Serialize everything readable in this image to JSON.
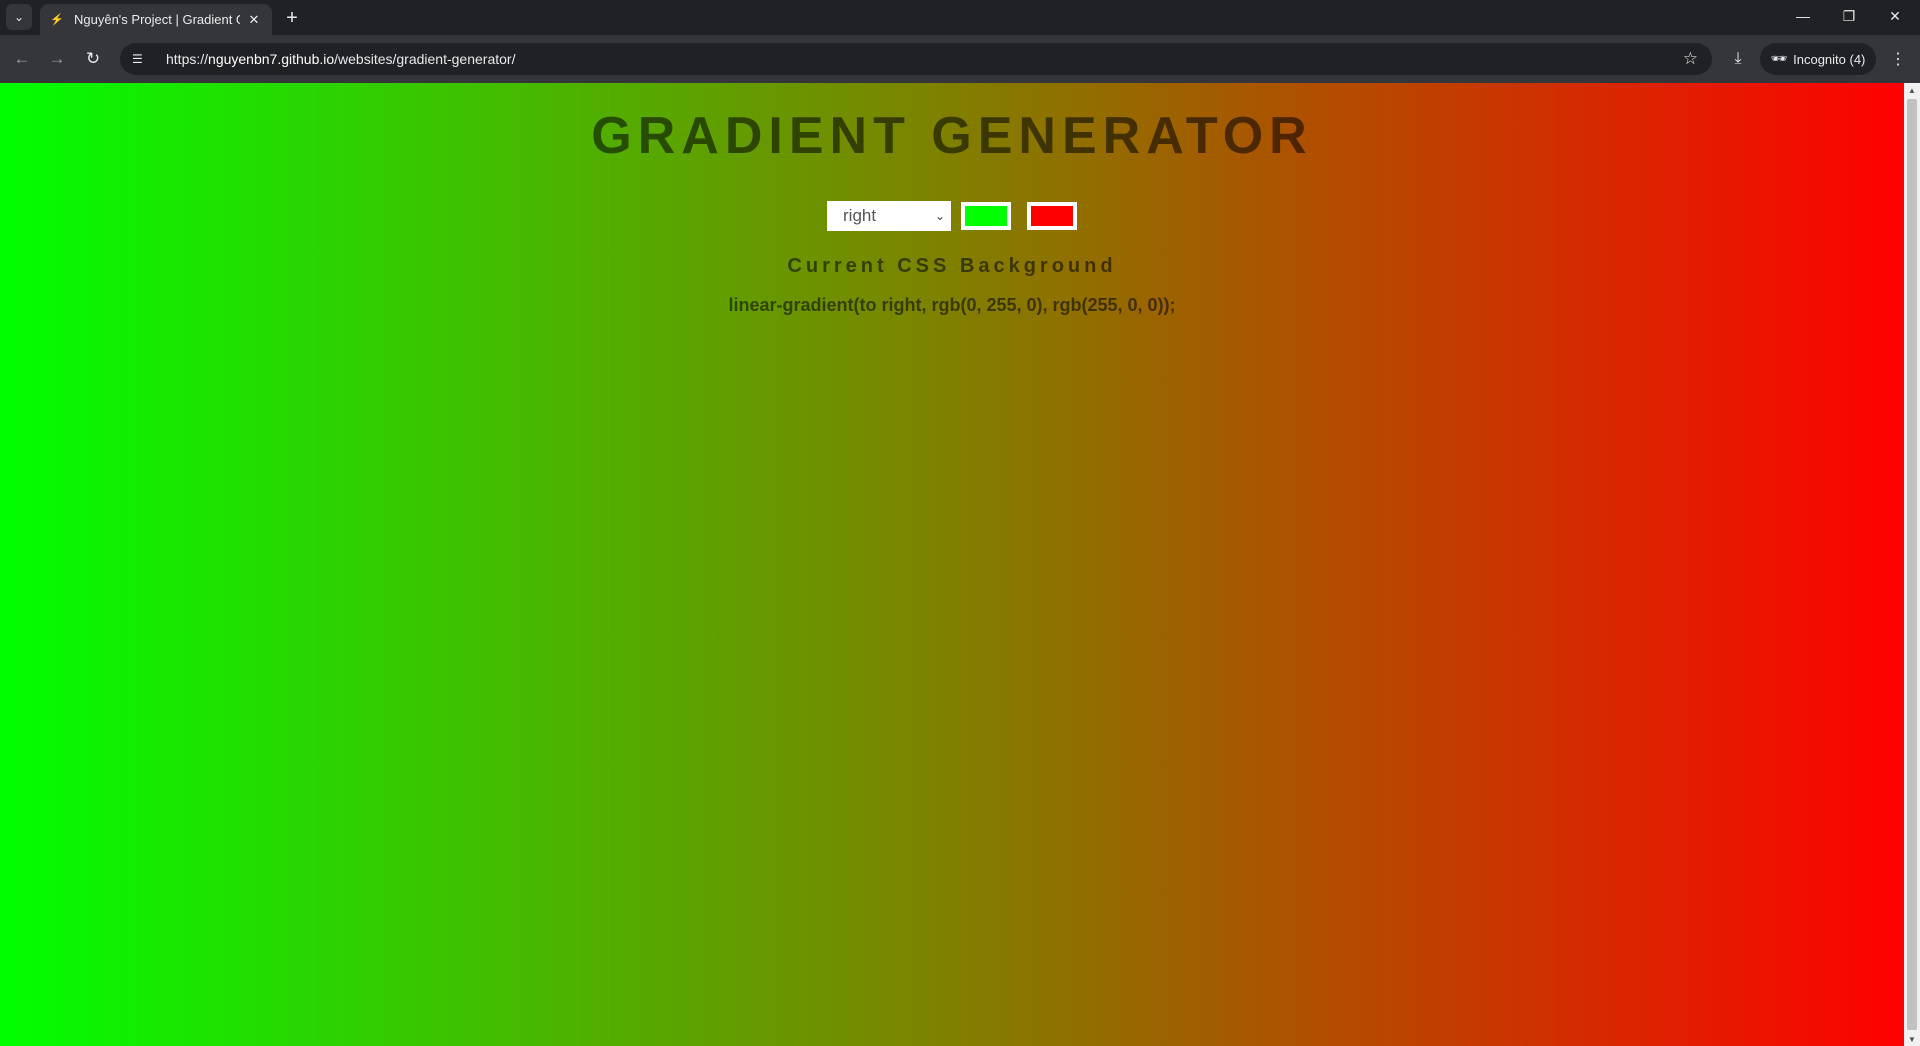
{
  "browser": {
    "tab_title": "Nguyên's Project | Gradient Ge",
    "tab_close": "✕",
    "new_tab": "+",
    "url_prefix": "https://",
    "url_host": "nguyenbn7.github.io",
    "url_path": "/websites/gradient-generator/",
    "incognito_label": "Incognito (4)",
    "window_controls": {
      "minimize": "—",
      "restore": "❐",
      "close": "✕"
    }
  },
  "page": {
    "title": "GRADIENT GENERATOR",
    "direction_value": "right",
    "color1": "#00ff00",
    "color2": "#ff0000",
    "subtitle": "Current CSS Background",
    "css_output": "linear-gradient(to right, rgb(0, 255, 0), rgb(255, 0, 0));"
  },
  "icons": {
    "tab_search": "chevron-down-icon",
    "back": "arrow-left-icon",
    "forward": "arrow-right-icon",
    "reload": "reload-icon",
    "site_info": "tune-icon",
    "bookmark": "star-icon",
    "download": "download-icon",
    "incognito": "incognito-icon",
    "menu": "kebab-menu-icon"
  }
}
